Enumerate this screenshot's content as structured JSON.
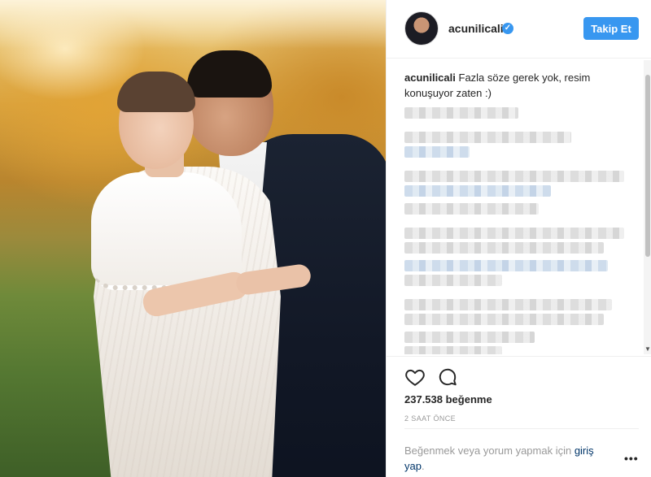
{
  "post": {
    "photo_alt": "Wedding photo of a couple",
    "header": {
      "username": "acunilicali",
      "verified_icon": "verified-check-icon",
      "follow_label": "Takip Et"
    },
    "caption": {
      "username": "acunilicali",
      "text": "Fazla söze gerek yok, resim konuşuyor zaten :)"
    },
    "likes": "237.538 beğenme",
    "timestamp": "2 SAAT ÖNCE",
    "login_prompt": {
      "text": "Beğenmek veya yorum yapmak için ",
      "link": "giriş yap",
      "suffix": "."
    },
    "more": "•••"
  },
  "colors": {
    "accent": "#3897f0",
    "text": "#262626",
    "muted": "#999999",
    "link": "#003569"
  },
  "icons": [
    "heart-icon",
    "comment-icon",
    "verified-check-icon",
    "more-options-icon"
  ]
}
